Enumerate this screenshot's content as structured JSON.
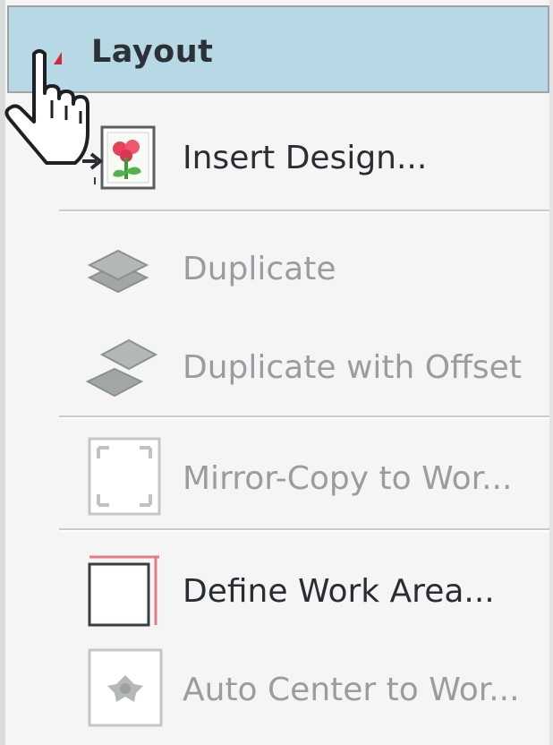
{
  "menu": {
    "title": "Layout",
    "items": [
      {
        "label": "Insert Design...",
        "enabled": true,
        "icon": "insert-design-icon"
      },
      {
        "label": "Duplicate",
        "enabled": false,
        "icon": "duplicate-icon"
      },
      {
        "label": "Duplicate with Offset",
        "enabled": false,
        "icon": "duplicate-offset-icon"
      },
      {
        "label": "Mirror-Copy to Wor...",
        "enabled": false,
        "icon": "mirror-copy-icon"
      },
      {
        "label": "Define Work Area...",
        "enabled": true,
        "icon": "define-work-area-icon"
      },
      {
        "label": "Auto Center to Wor...",
        "enabled": false,
        "icon": "auto-center-icon"
      }
    ]
  },
  "colors": {
    "header_bg": "#b7d9e6",
    "menu_bg": "#f4f5f4",
    "accent_red": "#d22a3d"
  },
  "cursor": "hand-pointer-icon"
}
